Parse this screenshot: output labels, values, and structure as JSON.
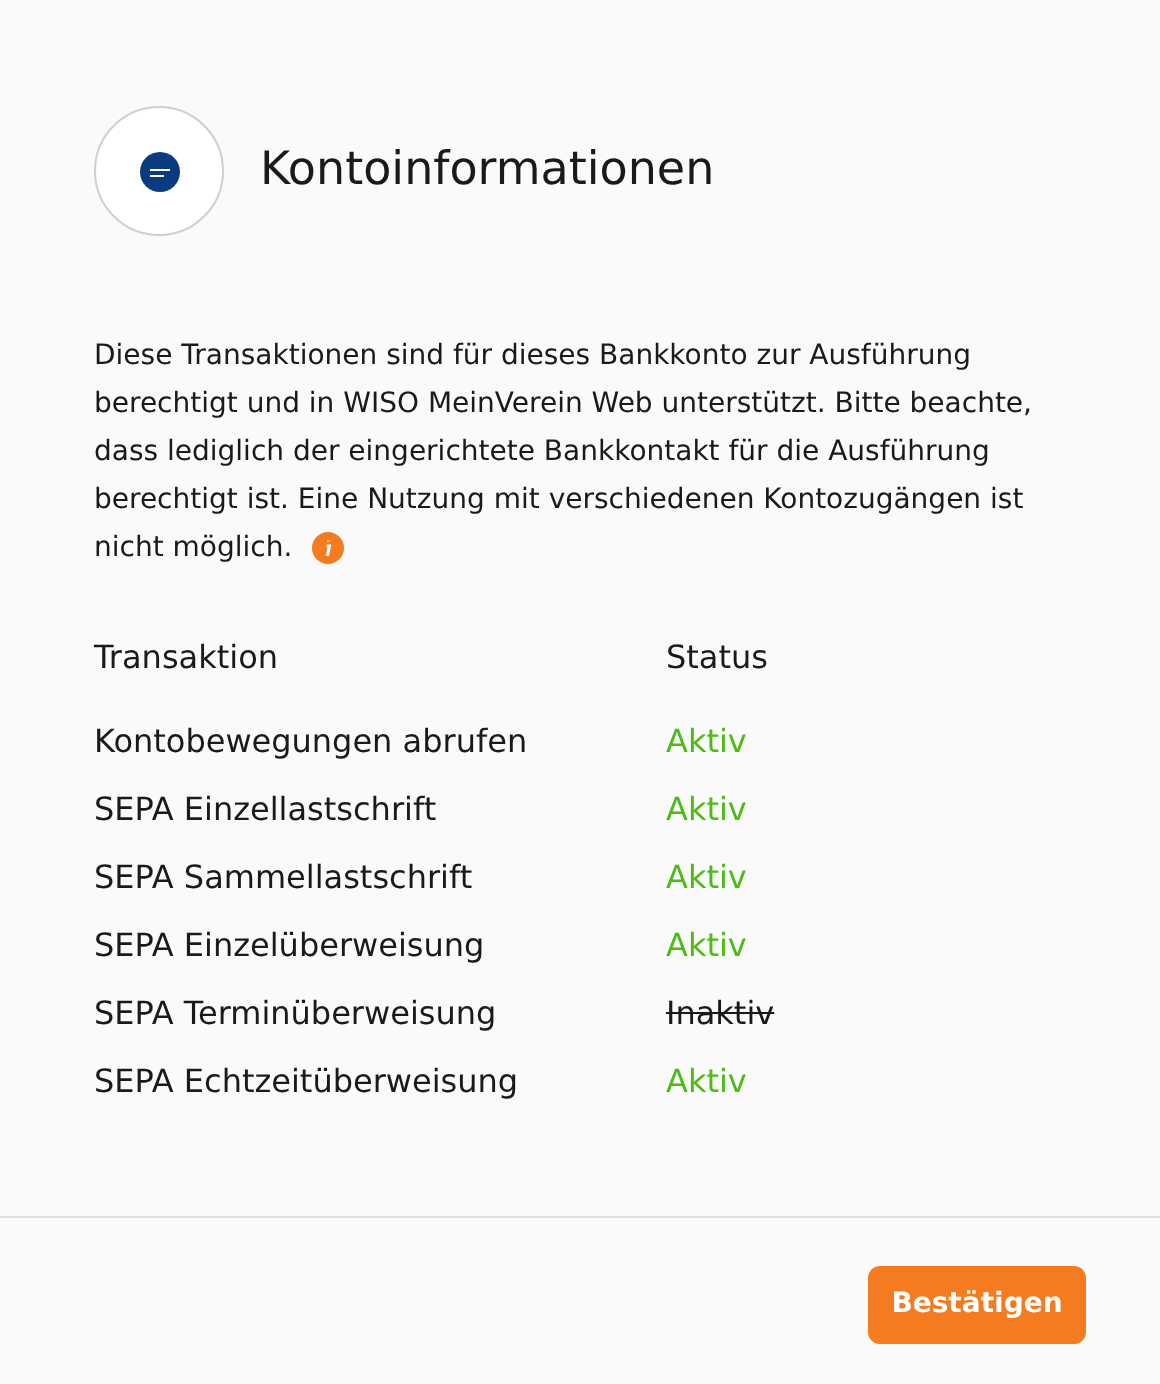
{
  "title": "Kontoinformationen",
  "description": [
    "Diese Transaktionen sind für dieses Bankkonto zur Ausführung berechtigt und in WISO MeinVerein Web unterstützt. Bitte beachte, dass lediglich der eingerichtete Bankkontakt für die Ausführung berechtigt ist. Eine Nutzung mit verschiedenen Kontozugängen ist",
    "nicht möglich."
  ],
  "table": {
    "columns": [
      "Transaktion",
      "Status"
    ],
    "rows": [
      {
        "transaction": "Kontobewegungen abrufen",
        "status": "Aktiv",
        "active": true
      },
      {
        "transaction": "SEPA Einzellastschrift",
        "status": "Aktiv",
        "active": true
      },
      {
        "transaction": "SEPA Sammellastschrift",
        "status": "Aktiv",
        "active": true
      },
      {
        "transaction": "SEPA Einzelüberweisung",
        "status": "Aktiv",
        "active": true
      },
      {
        "transaction": "SEPA Terminüberweisung",
        "status": "Inaktiv",
        "active": false
      },
      {
        "transaction": "SEPA Echtzeitüberweisung",
        "status": "Aktiv",
        "active": true
      }
    ]
  },
  "confirm_button": "Bestätigen"
}
